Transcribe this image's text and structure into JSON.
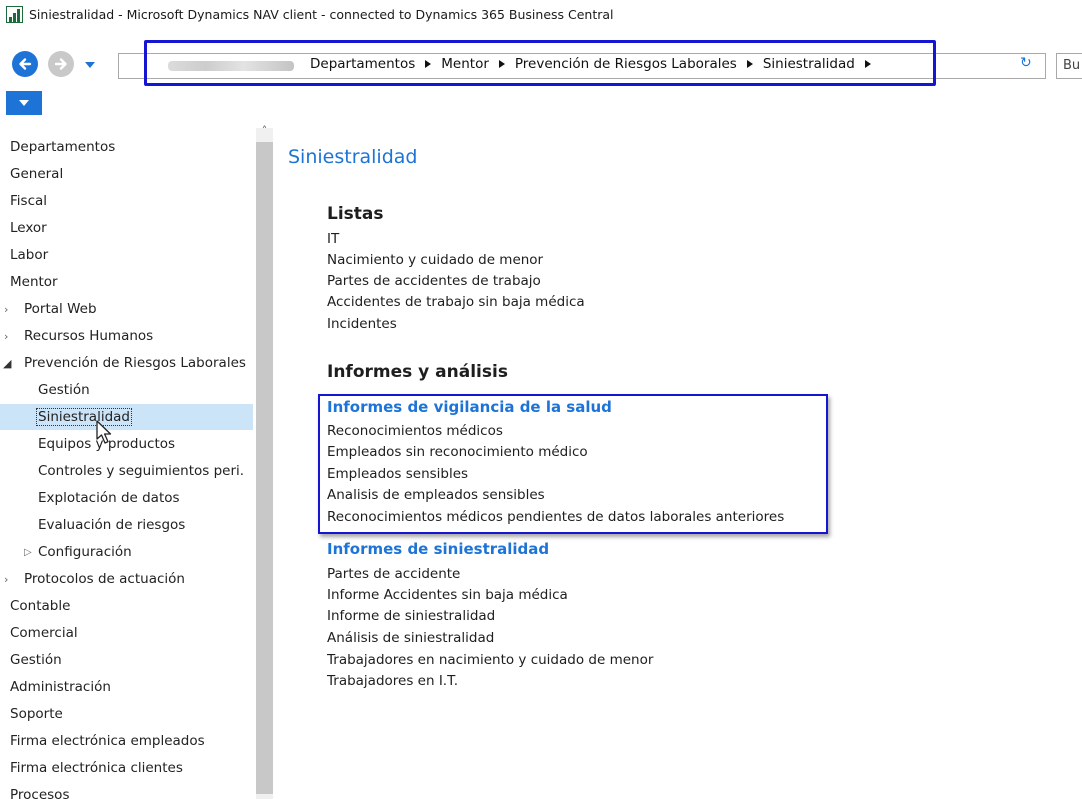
{
  "window": {
    "title": "Siniestralidad - Microsoft Dynamics NAV client - connected to Dynamics 365 Business Central"
  },
  "address_bar": {
    "breadcrumbs": [
      "Departamentos",
      "Mentor",
      "Prevención de Riesgos Laborales",
      "Siniestralidad"
    ],
    "search_label": "Bu"
  },
  "sidebar": {
    "items": [
      {
        "label": "Departamentos"
      },
      {
        "label": "General"
      },
      {
        "label": "Fiscal"
      },
      {
        "label": "Lexor"
      },
      {
        "label": "Labor"
      },
      {
        "label": "Mentor"
      },
      {
        "label": "Portal Web"
      },
      {
        "label": "Recursos Humanos"
      },
      {
        "label": "Prevención de Riesgos Laborales"
      },
      {
        "label": "Gestión"
      },
      {
        "label": "Siniestralidad",
        "selected": true
      },
      {
        "label": "Equipos y productos"
      },
      {
        "label": "Controles y seguimientos peri."
      },
      {
        "label": "Explotación de datos"
      },
      {
        "label": "Evaluación de riesgos"
      },
      {
        "label": "Configuración"
      },
      {
        "label": "Protocolos de actuación"
      },
      {
        "label": "Contable"
      },
      {
        "label": "Comercial"
      },
      {
        "label": "Gestión"
      },
      {
        "label": "Administración"
      },
      {
        "label": "Soporte"
      },
      {
        "label": "Firma electrónica empleados"
      },
      {
        "label": "Firma electrónica clientes"
      },
      {
        "label": "Procesos"
      }
    ]
  },
  "main": {
    "title": "Siniestralidad",
    "listas": {
      "heading": "Listas",
      "items": [
        "IT",
        "Nacimiento y cuidado de menor",
        "Partes de accidentes de trabajo",
        "Accidentes de trabajo sin baja médica",
        "Incidentes"
      ]
    },
    "informes": {
      "heading": "Informes y análisis",
      "vigilancia": {
        "heading": "Informes de vigilancia de la salud",
        "items": [
          "Reconocimientos médicos",
          "Empleados sin reconocimiento médico",
          "Empleados sensibles",
          "Analisis de empleados sensibles",
          "Reconocimientos médicos pendientes de datos laborales anteriores"
        ]
      },
      "siniestralidad": {
        "heading": "Informes de siniestralidad",
        "items": [
          "Partes de accidente",
          "Informe Accidentes sin baja médica",
          "Informe de siniestralidad",
          "Análisis de siniestralidad",
          "Trabajadores en nacimiento y cuidado de menor",
          "Trabajadores en I.T."
        ]
      }
    }
  },
  "colors": {
    "accent": "#1d74d6",
    "annotation_box": "#1515d2",
    "selection": "#cce4f7"
  }
}
